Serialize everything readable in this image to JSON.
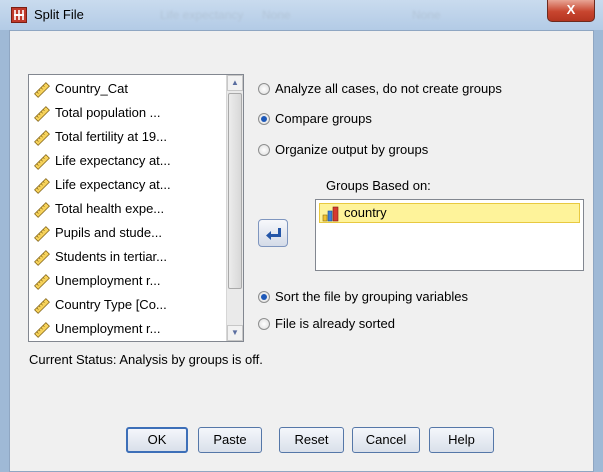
{
  "window": {
    "title": "Split File",
    "background_title_ghost": [
      "Life expectancy",
      "None",
      "None"
    ],
    "close_label": "X"
  },
  "variables": {
    "items": [
      {
        "label": "Country_Cat",
        "icon": "scale-variable-icon"
      },
      {
        "label": "Total population ...",
        "icon": "scale-variable-icon"
      },
      {
        "label": "Total fertility at 19...",
        "icon": "scale-variable-icon"
      },
      {
        "label": "Life expectancy at...",
        "icon": "scale-variable-icon"
      },
      {
        "label": "Life expectancy at...",
        "icon": "scale-variable-icon"
      },
      {
        "label": "Total health expe...",
        "icon": "scale-variable-icon"
      },
      {
        "label": "Pupils and stude...",
        "icon": "scale-variable-icon"
      },
      {
        "label": "Students in tertiar...",
        "icon": "scale-variable-icon"
      },
      {
        "label": "Unemployment r...",
        "icon": "scale-variable-icon"
      },
      {
        "label": "Country Type [Co...",
        "icon": "scale-variable-icon"
      },
      {
        "label": "Unemployment r...",
        "icon": "scale-variable-icon"
      }
    ]
  },
  "options": {
    "analyze_all": {
      "label": "Analyze all cases, do not create groups",
      "selected": false
    },
    "compare": {
      "label": "Compare groups",
      "selected": true
    },
    "organize": {
      "label": "Organize output by groups",
      "selected": false
    }
  },
  "groups": {
    "label": "Groups Based on:",
    "items": [
      {
        "label": "country",
        "icon": "nominal-variable-icon"
      }
    ]
  },
  "sort": {
    "sort_by_group": {
      "label": "Sort the file by grouping variables",
      "selected": true
    },
    "already_sorted": {
      "label": "File is already sorted",
      "selected": false
    }
  },
  "status": "Current Status: Analysis by groups is off.",
  "buttons": {
    "ok": "OK",
    "paste": "Paste",
    "reset": "Reset",
    "cancel": "Cancel",
    "help": "Help"
  },
  "colors": {
    "selection": "#fef39a",
    "radio_dot": "#1d58b8",
    "close_red": "#c8462f"
  }
}
